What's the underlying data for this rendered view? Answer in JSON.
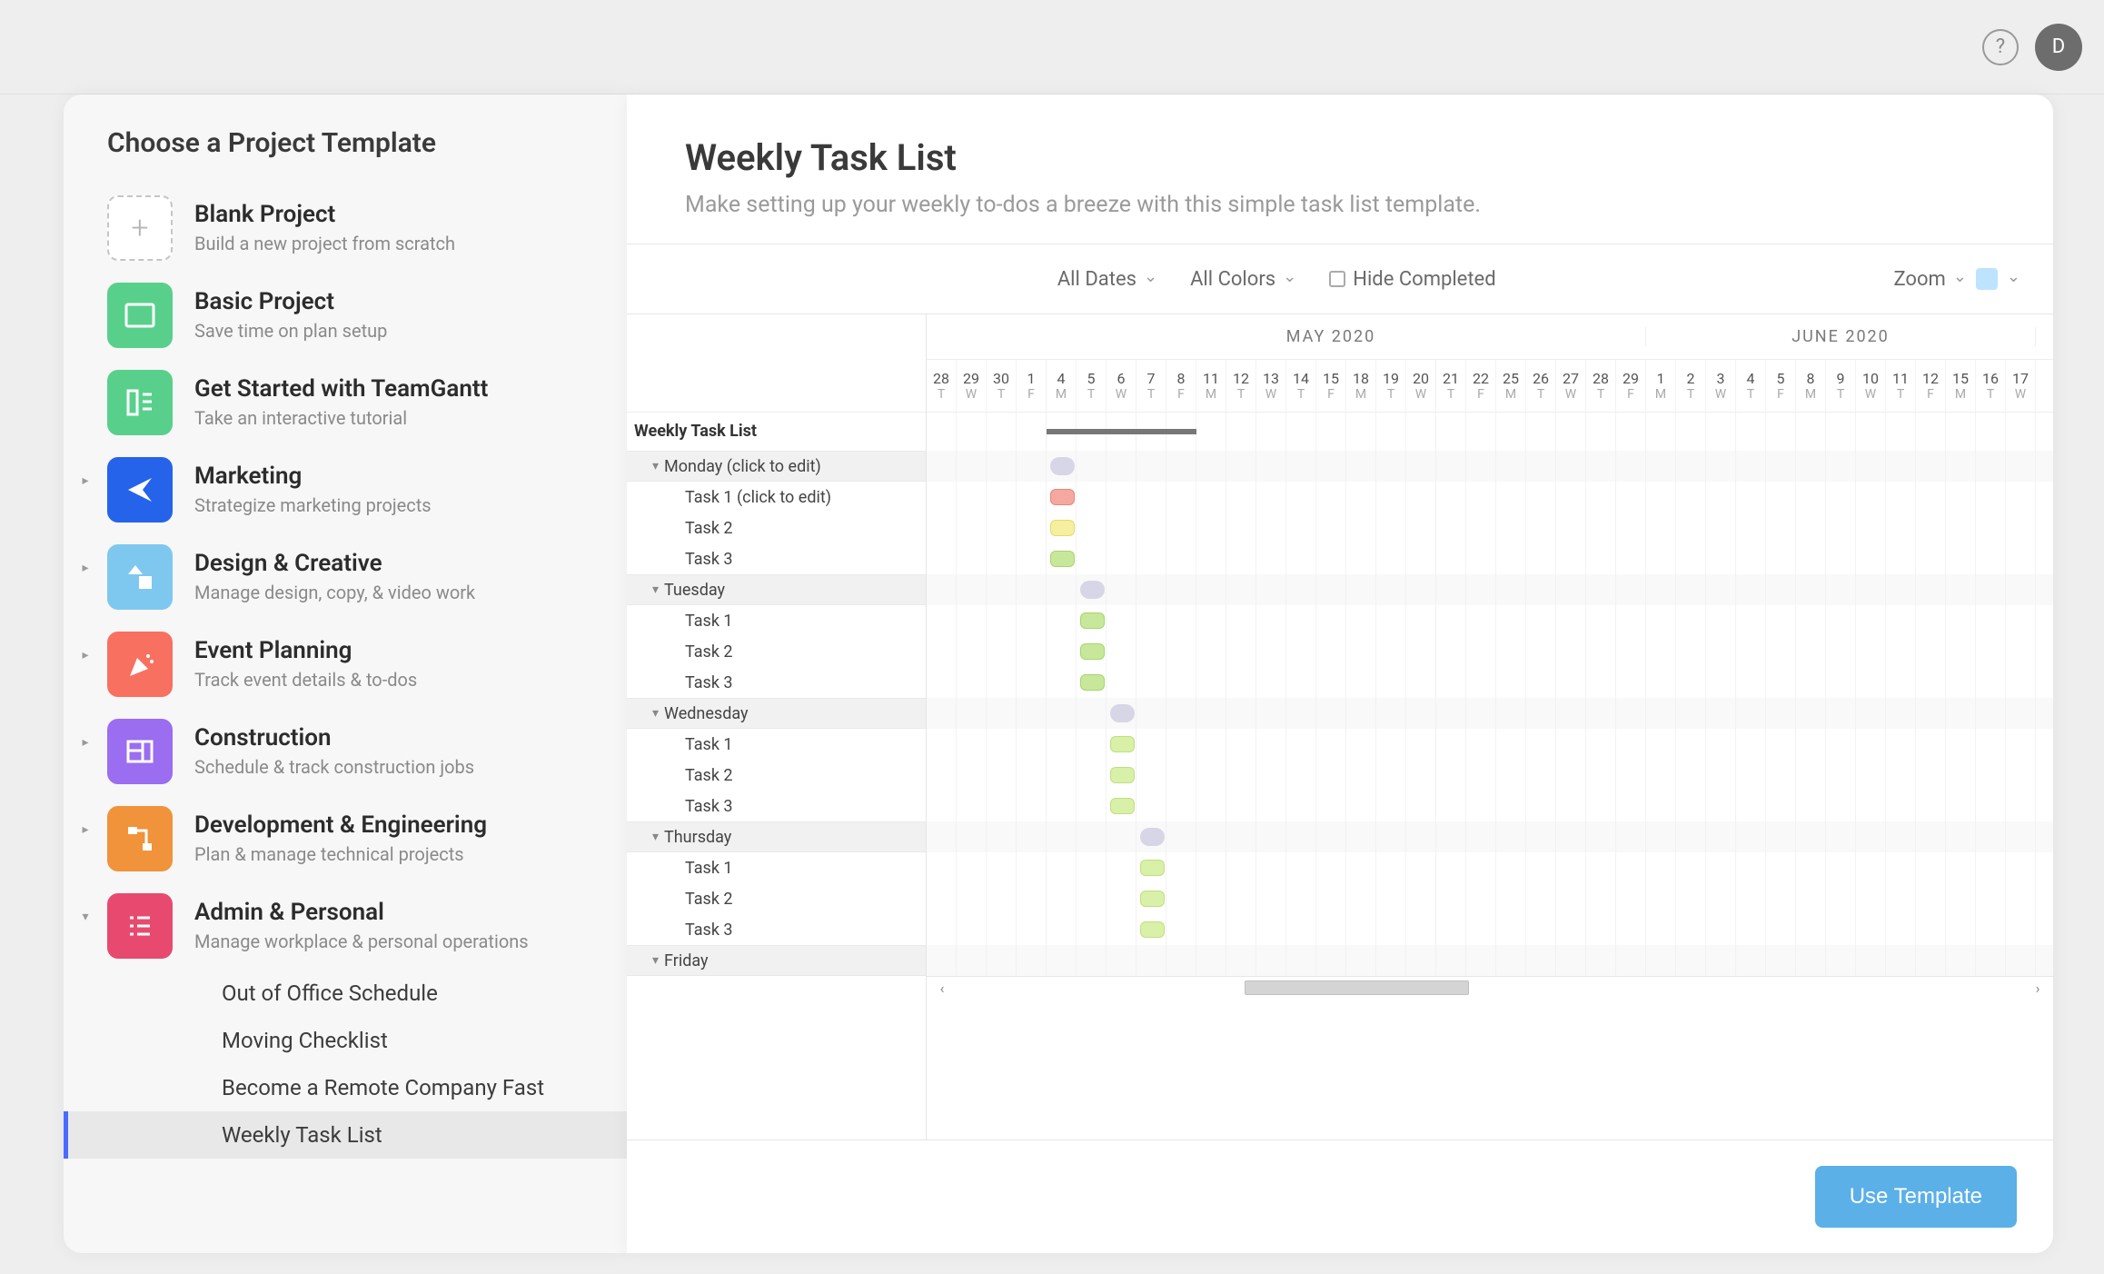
{
  "topbar": {
    "avatar_initial": "D"
  },
  "sidebar": {
    "title": "Choose a Project Template",
    "categories": [
      {
        "title": "Blank Project",
        "subtitle": "Build a new project from scratch",
        "icon": "plus",
        "expandable": false
      },
      {
        "title": "Basic Project",
        "subtitle": "Save time on plan setup",
        "icon": "rect",
        "expandable": false
      },
      {
        "title": "Get Started with TeamGantt",
        "subtitle": "Take an interactive tutorial",
        "icon": "guide",
        "expandable": false
      },
      {
        "title": "Marketing",
        "subtitle": "Strategize marketing projects",
        "icon": "send",
        "expandable": true,
        "expanded": false
      },
      {
        "title": "Design & Creative",
        "subtitle": "Manage design, copy, & video work",
        "icon": "shape",
        "expandable": true,
        "expanded": false
      },
      {
        "title": "Event Planning",
        "subtitle": "Track event details & to-dos",
        "icon": "party",
        "expandable": true,
        "expanded": false
      },
      {
        "title": "Construction",
        "subtitle": "Schedule & track construction jobs",
        "icon": "blueprint",
        "expandable": true,
        "expanded": false
      },
      {
        "title": "Development & Engineering",
        "subtitle": "Plan & manage technical projects",
        "icon": "flow",
        "expandable": true,
        "expanded": false
      },
      {
        "title": "Admin & Personal",
        "subtitle": "Manage workplace & personal operations",
        "icon": "list",
        "expandable": true,
        "expanded": true
      }
    ],
    "subitems": [
      "Out of Office Schedule",
      "Moving Checklist",
      "Become a Remote Company Fast",
      "Weekly Task List"
    ],
    "selected_subitem": 3
  },
  "preview": {
    "title": "Weekly Task List",
    "description": "Make setting up your weekly to-dos a breeze with this simple task list template.",
    "toolbar": {
      "all_dates": "All Dates",
      "all_colors": "All Colors",
      "hide_completed": "Hide Completed",
      "zoom": "Zoom"
    },
    "use_template": "Use Template"
  },
  "gantt": {
    "project": "Weekly Task List",
    "months": [
      {
        "label": "",
        "cols": 3
      },
      {
        "label": "MAY 2020",
        "cols": 21
      },
      {
        "label": "JUNE 2020",
        "cols": 13
      }
    ],
    "day_width": 33,
    "days": [
      {
        "n": "28",
        "d": "T"
      },
      {
        "n": "29",
        "d": "W"
      },
      {
        "n": "30",
        "d": "T"
      },
      {
        "n": "1",
        "d": "F"
      },
      {
        "n": "4",
        "d": "M"
      },
      {
        "n": "5",
        "d": "T"
      },
      {
        "n": "6",
        "d": "W"
      },
      {
        "n": "7",
        "d": "T"
      },
      {
        "n": "8",
        "d": "F"
      },
      {
        "n": "11",
        "d": "M"
      },
      {
        "n": "12",
        "d": "T"
      },
      {
        "n": "13",
        "d": "W"
      },
      {
        "n": "14",
        "d": "T"
      },
      {
        "n": "15",
        "d": "F"
      },
      {
        "n": "18",
        "d": "M"
      },
      {
        "n": "19",
        "d": "T"
      },
      {
        "n": "20",
        "d": "W"
      },
      {
        "n": "21",
        "d": "T"
      },
      {
        "n": "22",
        "d": "F"
      },
      {
        "n": "25",
        "d": "M"
      },
      {
        "n": "26",
        "d": "T"
      },
      {
        "n": "27",
        "d": "W"
      },
      {
        "n": "28",
        "d": "T"
      },
      {
        "n": "29",
        "d": "F"
      },
      {
        "n": "1",
        "d": "M"
      },
      {
        "n": "2",
        "d": "T"
      },
      {
        "n": "3",
        "d": "W"
      },
      {
        "n": "4",
        "d": "T"
      },
      {
        "n": "5",
        "d": "F"
      },
      {
        "n": "8",
        "d": "M"
      },
      {
        "n": "9",
        "d": "T"
      },
      {
        "n": "10",
        "d": "W"
      },
      {
        "n": "11",
        "d": "T"
      },
      {
        "n": "12",
        "d": "F"
      },
      {
        "n": "15",
        "d": "M"
      },
      {
        "n": "16",
        "d": "T"
      },
      {
        "n": "17",
        "d": "W"
      }
    ],
    "rows": [
      {
        "type": "title"
      },
      {
        "type": "group",
        "label": "Monday (click to edit)",
        "bar": {
          "start": 4,
          "span": 1,
          "cls": "bubble"
        }
      },
      {
        "type": "task",
        "label": "Task 1 (click to edit)",
        "bar": {
          "start": 4,
          "span": 1,
          "cls": "red"
        }
      },
      {
        "type": "task",
        "label": "Task 2",
        "bar": {
          "start": 4,
          "span": 1,
          "cls": "yellow"
        }
      },
      {
        "type": "task",
        "label": "Task 3",
        "bar": {
          "start": 4,
          "span": 1,
          "cls": "green"
        }
      },
      {
        "type": "group",
        "label": "Tuesday",
        "bar": {
          "start": 5,
          "span": 1,
          "cls": "bubble"
        }
      },
      {
        "type": "task",
        "label": "Task 1",
        "bar": {
          "start": 5,
          "span": 1,
          "cls": "green"
        }
      },
      {
        "type": "task",
        "label": "Task 2",
        "bar": {
          "start": 5,
          "span": 1,
          "cls": "green"
        }
      },
      {
        "type": "task",
        "label": "Task 3",
        "bar": {
          "start": 5,
          "span": 1,
          "cls": "green"
        }
      },
      {
        "type": "group",
        "label": "Wednesday",
        "bar": {
          "start": 6,
          "span": 1,
          "cls": "bubble"
        }
      },
      {
        "type": "task",
        "label": "Task 1",
        "bar": {
          "start": 6,
          "span": 1,
          "cls": "lime"
        }
      },
      {
        "type": "task",
        "label": "Task 2",
        "bar": {
          "start": 6,
          "span": 1,
          "cls": "lime"
        }
      },
      {
        "type": "task",
        "label": "Task 3",
        "bar": {
          "start": 6,
          "span": 1,
          "cls": "lime"
        }
      },
      {
        "type": "group",
        "label": "Thursday",
        "bar": {
          "start": 7,
          "span": 1,
          "cls": "bubble"
        }
      },
      {
        "type": "task",
        "label": "Task 1",
        "bar": {
          "start": 7,
          "span": 1,
          "cls": "lime"
        }
      },
      {
        "type": "task",
        "label": "Task 2",
        "bar": {
          "start": 7,
          "span": 1,
          "cls": "lime"
        }
      },
      {
        "type": "task",
        "label": "Task 3",
        "bar": {
          "start": 7,
          "span": 1,
          "cls": "lime"
        }
      },
      {
        "type": "group",
        "label": "Friday",
        "bar": null
      }
    ],
    "progress": {
      "start": 4,
      "span": 5
    },
    "scrollbar": {
      "pos": 0.27,
      "width": 0.21
    }
  }
}
